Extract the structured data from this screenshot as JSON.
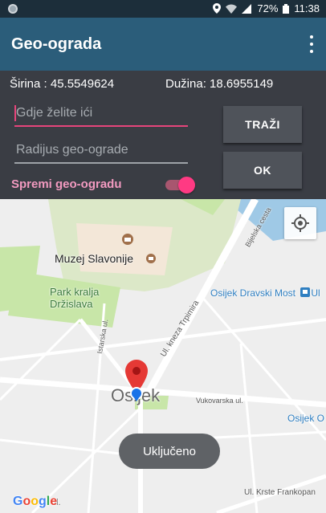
{
  "status_bar": {
    "battery": "72%",
    "time": "11:38",
    "icons": [
      "app-icon",
      "location-icon",
      "wifi-icon",
      "signal-icon",
      "battery-icon"
    ]
  },
  "app_bar": {
    "title": "Geo-ograda",
    "menu_icon": "overflow-menu-icon"
  },
  "coordinates": {
    "latitude_text": "Širina : 45.5549624",
    "longitude_text": "Dužina: 18.6955149"
  },
  "form": {
    "destination_placeholder": "Gdje želite ići",
    "radius_placeholder": "Radijus geo-ograde",
    "search_button": "TRAŽI",
    "ok_button": "OK",
    "save_switch_label": "Spremi geo-ogradu",
    "save_switch_on": true
  },
  "map": {
    "labels": {
      "museum": "Muzej Slavonije",
      "park": "Park kralja\nDržislava",
      "dravski": "Osijek Dravski Most",
      "dravski_suffix": "Ul",
      "osijek_o": "Osijek O",
      "city": "Osijek",
      "vukovarska": "Vukovarska ul.",
      "krste": "Ul. Krste Frankopan",
      "google": "Google",
      "ul": "ul.",
      "bijelska": "Bijelska cesta",
      "trpimira": "Ul. kneza Trpimira",
      "istarska": "Istarska ul."
    },
    "colors": {
      "marker": "#e53935",
      "my_location": "#1a73e8",
      "park": "#c8e6a8",
      "water": "#9fc9e6"
    }
  },
  "toast": {
    "text": "Uključeno"
  }
}
